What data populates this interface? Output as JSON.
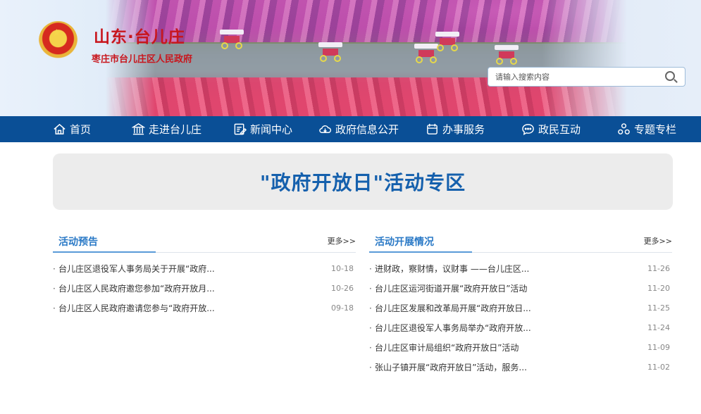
{
  "header": {
    "title": "山东·台儿庄",
    "subtitle": "枣庄市台儿庄区人民政府",
    "search_placeholder": "请输入搜索内容"
  },
  "nav": {
    "items": [
      {
        "label": "首页",
        "icon": "home-icon"
      },
      {
        "label": "走进台儿庄",
        "icon": "building-icon"
      },
      {
        "label": "新闻中心",
        "icon": "news-icon"
      },
      {
        "label": "政府信息公开",
        "icon": "cloud-icon"
      },
      {
        "label": "办事服务",
        "icon": "calendar-icon"
      },
      {
        "label": "政民互动",
        "icon": "chat-icon"
      },
      {
        "label": "专题专栏",
        "icon": "topics-icon"
      }
    ]
  },
  "banner": {
    "title": "\"政府开放日\"活动专区"
  },
  "left_column": {
    "title": "活动预告",
    "more": "更多>>",
    "items": [
      {
        "text": "台儿庄区退役军人事务局关于开展“政府...",
        "date": "10-18"
      },
      {
        "text": "台儿庄区人民政府邀您参加“政府开放月...",
        "date": "10-26"
      },
      {
        "text": "台儿庄区人民政府邀请您参与“政府开放...",
        "date": "09-18"
      }
    ]
  },
  "right_column": {
    "title": "活动开展情况",
    "more": "更多>>",
    "items": [
      {
        "text": "进财政，察财情，议财事 ——台儿庄区...",
        "date": "11-26"
      },
      {
        "text": "台儿庄区运河街道开展“政府开放日”活动",
        "date": "11-20"
      },
      {
        "text": "台儿庄区发展和改革局开展“政府开放日...",
        "date": "11-25"
      },
      {
        "text": "台儿庄区退役军人事务局举办“政府开放...",
        "date": "11-24"
      },
      {
        "text": "台儿庄区审计局组织“政府开放日”活动",
        "date": "11-09"
      },
      {
        "text": "张山子镇开展“政府开放日”活动，服务...",
        "date": "11-02"
      }
    ]
  },
  "colors": {
    "nav_bg": "#0a4f96",
    "title_red": "#c8161d",
    "banner_title_blue": "#1560ad",
    "section_title_blue": "#2a79c6"
  }
}
